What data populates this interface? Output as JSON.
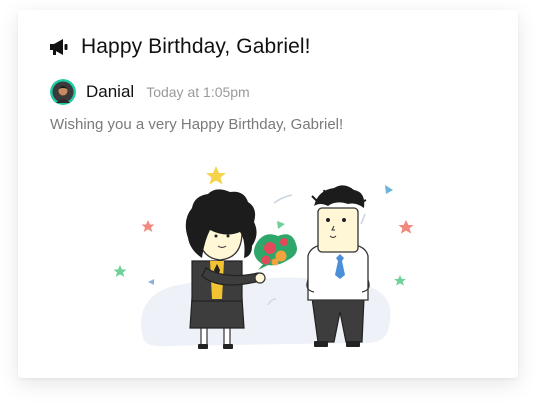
{
  "post": {
    "title": "Happy Birthday, Gabriel!",
    "title_icon": "megaphone-icon",
    "author": "Danial",
    "timestamp": "Today at 1:05pm",
    "message": "Wishing you a very Happy Birthday, Gabriel!",
    "illustration": "birthday-celebration-illustration"
  },
  "colors": {
    "card_background": "#ffffff",
    "title_text": "#111111",
    "muted_text": "#9a9a9a",
    "message_text": "#7a7a7a",
    "avatar_ring": "#1fc9a6"
  }
}
